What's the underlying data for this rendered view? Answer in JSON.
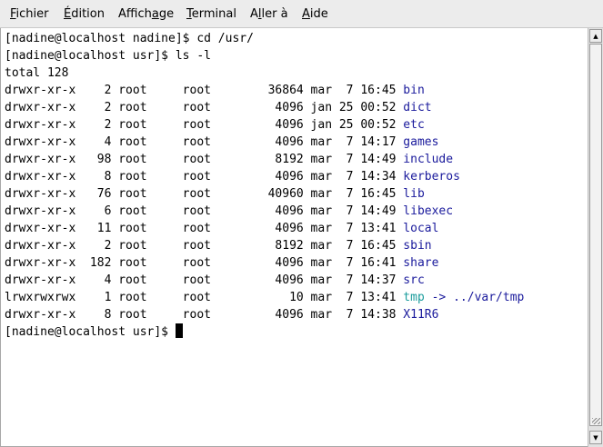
{
  "menubar": {
    "items": [
      {
        "pre": "",
        "mn": "F",
        "post": "ichier"
      },
      {
        "pre": "",
        "mn": "É",
        "post": "dition"
      },
      {
        "pre": "Affich",
        "mn": "a",
        "post": "ge"
      },
      {
        "pre": "",
        "mn": "T",
        "post": "erminal"
      },
      {
        "pre": "A",
        "mn": "l",
        "post": "ler à"
      },
      {
        "pre": "",
        "mn": "A",
        "post": "ide"
      }
    ]
  },
  "terminal": {
    "lines": [
      {
        "text": "[nadine@localhost nadine]$ cd /usr/"
      },
      {
        "text": "[nadine@localhost usr]$ ls -l"
      },
      {
        "text": "total 128"
      },
      {
        "text": "drwxr-xr-x    2 root     root        36864 mar  7 16:45 ",
        "name": "bin",
        "kind": "dir"
      },
      {
        "text": "drwxr-xr-x    2 root     root         4096 jan 25 00:52 ",
        "name": "dict",
        "kind": "dir"
      },
      {
        "text": "drwxr-xr-x    2 root     root         4096 jan 25 00:52 ",
        "name": "etc",
        "kind": "dir"
      },
      {
        "text": "drwxr-xr-x    4 root     root         4096 mar  7 14:17 ",
        "name": "games",
        "kind": "dir"
      },
      {
        "text": "drwxr-xr-x   98 root     root         8192 mar  7 14:49 ",
        "name": "include",
        "kind": "dir"
      },
      {
        "text": "drwxr-xr-x    8 root     root         4096 mar  7 14:34 ",
        "name": "kerberos",
        "kind": "dir"
      },
      {
        "text": "drwxr-xr-x   76 root     root        40960 mar  7 16:45 ",
        "name": "lib",
        "kind": "dir"
      },
      {
        "text": "drwxr-xr-x    6 root     root         4096 mar  7 14:49 ",
        "name": "libexec",
        "kind": "dir"
      },
      {
        "text": "drwxr-xr-x   11 root     root         4096 mar  7 13:41 ",
        "name": "local",
        "kind": "dir"
      },
      {
        "text": "drwxr-xr-x    2 root     root         8192 mar  7 16:45 ",
        "name": "sbin",
        "kind": "dir"
      },
      {
        "text": "drwxr-xr-x  182 root     root         4096 mar  7 16:41 ",
        "name": "share",
        "kind": "dir"
      },
      {
        "text": "drwxr-xr-x    4 root     root         4096 mar  7 14:37 ",
        "name": "src",
        "kind": "dir"
      },
      {
        "text": "lrwxrwxrwx    1 root     root           10 mar  7 13:41 ",
        "name": "tmp",
        "kind": "link",
        "target": " -> ../var/tmp"
      },
      {
        "text": "drwxr-xr-x    8 root     root         4096 mar  7 14:38 ",
        "name": "X11R6",
        "kind": "dir"
      },
      {
        "text": "[nadine@localhost usr]$ ",
        "cursor": true
      }
    ]
  },
  "colors": {
    "directory": "#1a1a9c",
    "symlink": "#1a9c9c",
    "menubar_bg": "#ececec",
    "terminal_bg": "#ffffff"
  },
  "icons": {
    "scroll_up": "scroll-up-arrow-icon",
    "scroll_down": "scroll-down-arrow-icon"
  }
}
